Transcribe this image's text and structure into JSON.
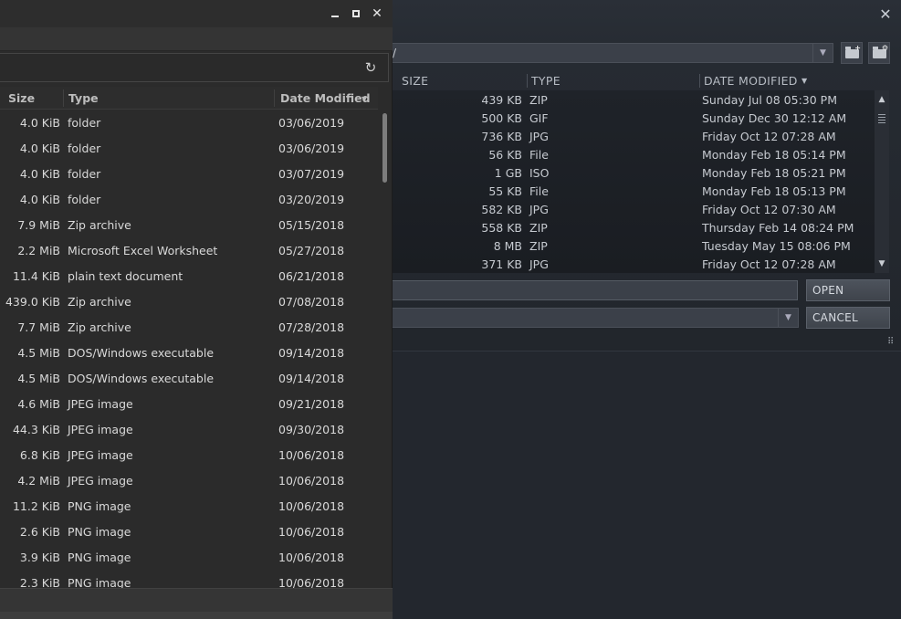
{
  "steam_dialog": {
    "close_glyph": "✕",
    "path_value": "/",
    "columns": {
      "size": "SIZE",
      "type": "TYPE",
      "date": "DATE MODIFIED"
    },
    "rows": [
      {
        "size": "439 KB",
        "type": "ZIP",
        "date": "Sunday Jul 08 05:30 PM"
      },
      {
        "size": "500 KB",
        "type": "GIF",
        "date": "Sunday Dec 30 12:12 AM"
      },
      {
        "size": "736 KB",
        "type": "JPG",
        "date": "Friday Oct 12 07:28 AM"
      },
      {
        "size": "56 KB",
        "type": "File",
        "date": "Monday Feb 18 05:14 PM"
      },
      {
        "size": "1 GB",
        "type": "ISO",
        "date": "Monday Feb 18 05:21 PM"
      },
      {
        "size": "55 KB",
        "type": "File",
        "date": "Monday Feb 18 05:13 PM"
      },
      {
        "size": "582 KB",
        "type": "JPG",
        "date": "Friday Oct 12 07:30 AM"
      },
      {
        "size": "558 KB",
        "type": "ZIP",
        "date": "Thursday Feb 14 08:24 PM"
      },
      {
        "size": "8 MB",
        "type": "ZIP",
        "date": "Tuesday May 15 08:06 PM"
      },
      {
        "size": "371 KB",
        "type": "JPG",
        "date": "Friday Oct 12 07:28 AM"
      }
    ],
    "filename_value": "",
    "open_label": "OPEN",
    "cancel_label": "CANCEL",
    "icons": {
      "new_folder": "folder-plus-icon",
      "folder_options": "folder-settings-icon"
    }
  },
  "gtk_dialog": {
    "columns": {
      "size": "Size",
      "type": "Type",
      "date": "Date Modified"
    },
    "rows": [
      {
        "size": "4.0 KiB",
        "type": "folder",
        "date": "03/06/2019"
      },
      {
        "size": "4.0 KiB",
        "type": "folder",
        "date": "03/06/2019"
      },
      {
        "size": "4.0 KiB",
        "type": "folder",
        "date": "03/07/2019"
      },
      {
        "size": "4.0 KiB",
        "type": "folder",
        "date": "03/20/2019"
      },
      {
        "size": "7.9 MiB",
        "type": "Zip archive",
        "date": "05/15/2018"
      },
      {
        "size": "2.2 MiB",
        "type": "Microsoft Excel Worksheet",
        "date": "05/27/2018"
      },
      {
        "size": "11.4 KiB",
        "type": "plain text document",
        "date": "06/21/2018"
      },
      {
        "size": "439.0 KiB",
        "type": "Zip archive",
        "date": "07/08/2018"
      },
      {
        "size": "7.7 MiB",
        "type": "Zip archive",
        "date": "07/28/2018"
      },
      {
        "size": "4.5 MiB",
        "type": "DOS/Windows executable",
        "date": "09/14/2018"
      },
      {
        "size": "4.5 MiB",
        "type": "DOS/Windows executable",
        "date": "09/14/2018"
      },
      {
        "size": "4.6 MiB",
        "type": "JPEG image",
        "date": "09/21/2018"
      },
      {
        "size": "44.3 KiB",
        "type": "JPEG image",
        "date": "09/30/2018"
      },
      {
        "size": "6.8 KiB",
        "type": "JPEG image",
        "date": "10/06/2018"
      },
      {
        "size": "4.2 MiB",
        "type": "JPEG image",
        "date": "10/06/2018"
      },
      {
        "size": "11.2 KiB",
        "type": "PNG image",
        "date": "10/06/2018"
      },
      {
        "size": "2.6 KiB",
        "type": "PNG image",
        "date": "10/06/2018"
      },
      {
        "size": "3.9 KiB",
        "type": "PNG image",
        "date": "10/06/2018"
      },
      {
        "size": "2.3 KiB",
        "type": "PNG image",
        "date": "10/06/2018"
      }
    ]
  }
}
